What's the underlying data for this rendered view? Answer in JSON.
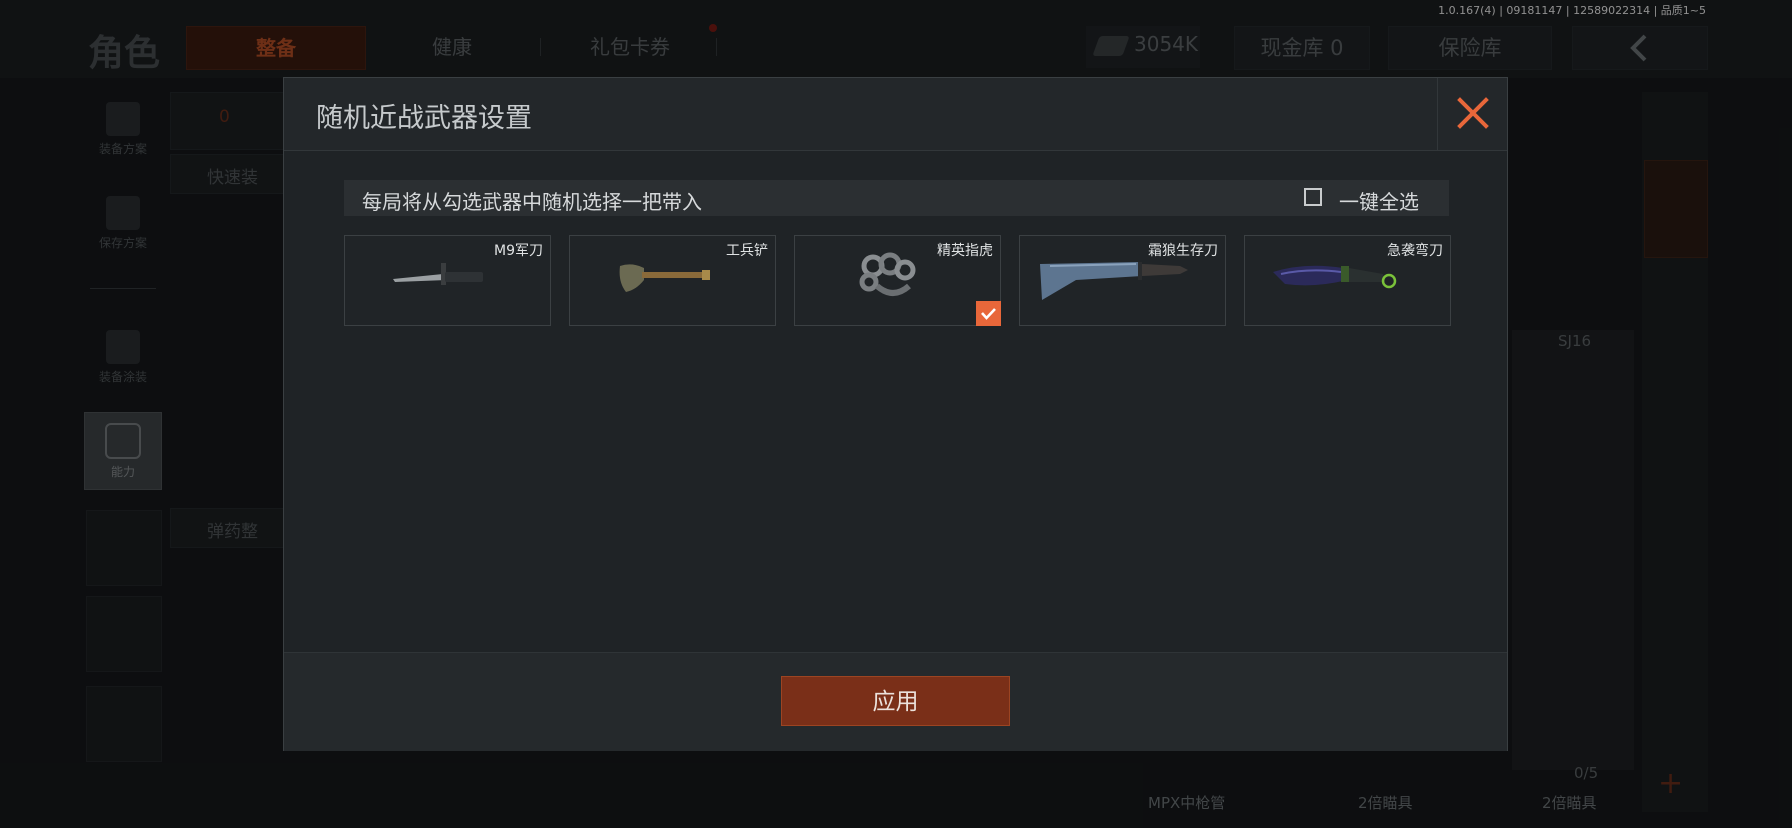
{
  "version_text": "1.0.167(4) | 09181147 | 12589022314 | 品质1~5",
  "header": {
    "section_title": "角色",
    "tabs": [
      {
        "label": "整备",
        "active": true
      },
      {
        "label": "健康",
        "active": false
      },
      {
        "label": "礼包卡券",
        "active": false
      }
    ],
    "money": "3054K",
    "cash_vault": "现金库 0",
    "safe_box": "保险库"
  },
  "sidebar": {
    "items": [
      {
        "label": "装备方案",
        "icon": "vest-icon"
      },
      {
        "label": "保存方案",
        "icon": "download-icon"
      },
      {
        "label": "装备涂装",
        "icon": "helmet-icon"
      },
      {
        "label": "能力",
        "icon": "ability-icon"
      }
    ]
  },
  "background": {
    "status_count": "0",
    "quick_equip": "快速装",
    "ammo_label": "弹药整",
    "weapon_model": "SJ16",
    "slot_count": "0/5",
    "bottom_items": [
      "MPX中枪管",
      "2倍瞄具",
      "2倍瞄具"
    ]
  },
  "modal": {
    "title": "随机近战武器设置",
    "instruction": "每局将从勾选武器中随机选择一把带入",
    "select_all_label": "一键全选",
    "select_all_checked": false,
    "weapons": [
      {
        "name": "M9军刀",
        "selected": false,
        "icon": "bayonet-icon"
      },
      {
        "name": "工兵铲",
        "selected": false,
        "icon": "shovel-icon"
      },
      {
        "name": "精英指虎",
        "selected": true,
        "icon": "knuckles-icon"
      },
      {
        "name": "霜狼生存刀",
        "selected": false,
        "icon": "machete-icon"
      },
      {
        "name": "急袭弯刀",
        "selected": false,
        "icon": "karambit-icon"
      }
    ],
    "apply_label": "应用"
  },
  "colors": {
    "accent": "#e8673a",
    "apply_button": "#7a2f18",
    "close_icon": "#e8673a"
  }
}
